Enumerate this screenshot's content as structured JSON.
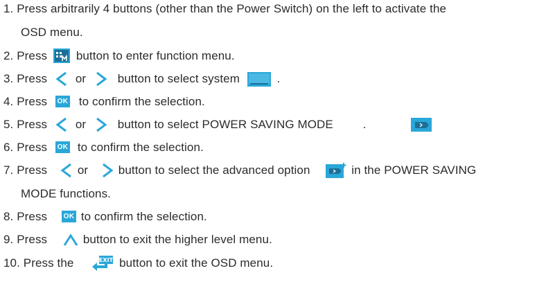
{
  "colors": {
    "text": "#2b2b2b",
    "accent": "#29a7d9",
    "panel_dark": "#1c6f96"
  },
  "lines": [
    {
      "t1": "1. Press arbitrarily 4 buttons (other than the Power Switch) on the left to activate the"
    },
    {
      "t1": "OSD menu."
    },
    {
      "t1": "2. Press",
      "t2": "button to enter function menu."
    },
    {
      "t1": "3. Press",
      "t2": "or",
      "t3": "button to select system",
      "t4": "."
    },
    {
      "t1": "4. Press",
      "ok": "OK",
      "t2": "to confirm the selection."
    },
    {
      "t1": "5. Press",
      "t2": "or",
      "t3": "button to select POWER SAVING MODE",
      "t4": "."
    },
    {
      "t1": "6. Press",
      "ok": "OK",
      "t2": "to confirm the selection."
    },
    {
      "t1": "7. Press",
      "t2": "or",
      "t3": "button to select the advanced option",
      "t4": "in the POWER SAVING"
    },
    {
      "t1": "MODE functions."
    },
    {
      "t1": "8. Press",
      "ok": "OK",
      "t2": "to confirm the selection."
    },
    {
      "t1": "9. Press",
      "t2": "button to exit the higher level menu."
    },
    {
      "t1": "10. Press the",
      "t2": "button to exit the OSD menu."
    }
  ],
  "icons": {
    "menu": "menu-button-icon",
    "left": "left-arrow-icon",
    "right": "right-arrow-icon",
    "system": "system-screen-icon",
    "power_saving": "power-saving-battery-icon",
    "advanced": "advanced-option-icon",
    "up": "up-arrow-icon",
    "exit": "exit-button-icon"
  }
}
